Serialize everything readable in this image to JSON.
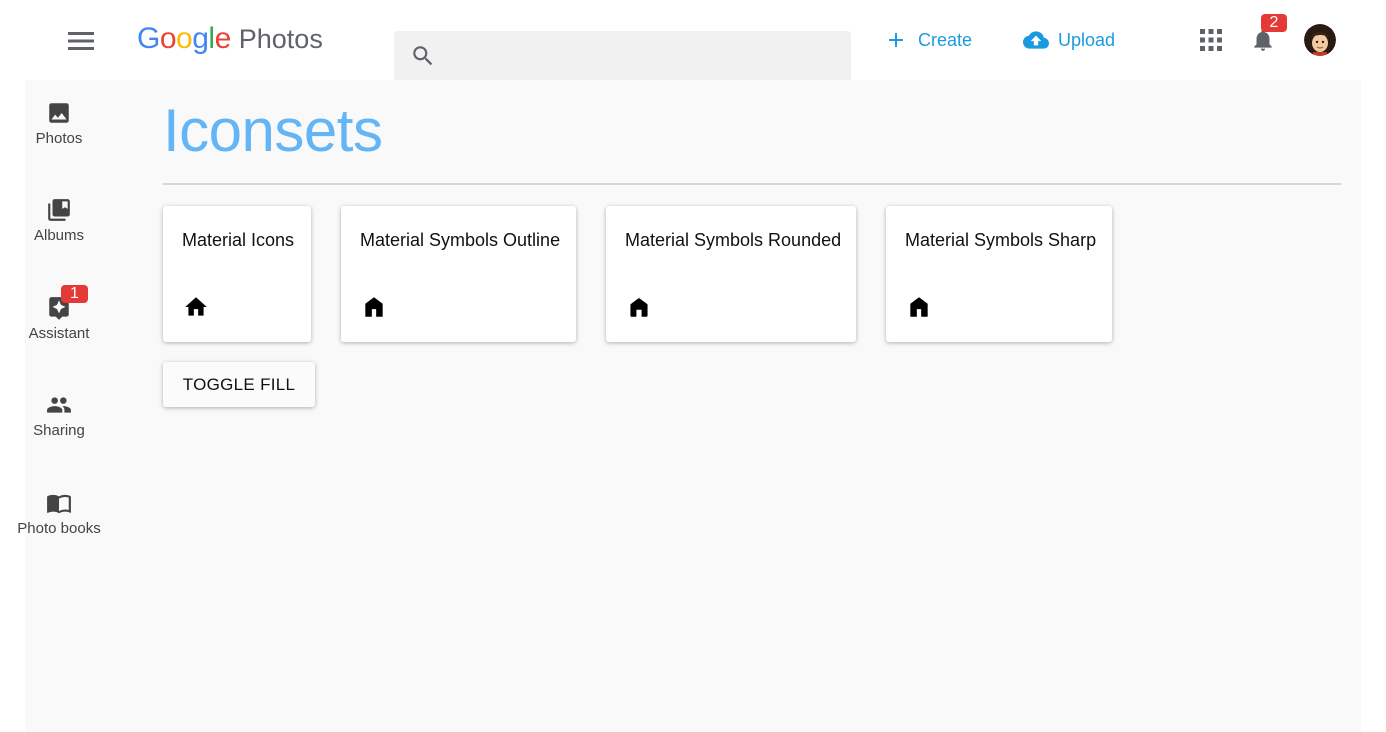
{
  "header": {
    "logo_letters": [
      {
        "ch": "G",
        "color": "#4285f4"
      },
      {
        "ch": "o",
        "color": "#ea4335"
      },
      {
        "ch": "o",
        "color": "#fbbc05"
      },
      {
        "ch": "g",
        "color": "#4285f4"
      },
      {
        "ch": "l",
        "color": "#34a853"
      },
      {
        "ch": "e",
        "color": "#ea4335"
      }
    ],
    "app_name": "Photos",
    "search_placeholder": "",
    "create_label": "Create",
    "upload_label": "Upload",
    "notification_count": "2",
    "accent_color": "#1a9be0"
  },
  "sidebar": {
    "items": [
      {
        "label": "Photos",
        "icon": "photo-icon"
      },
      {
        "label": "Albums",
        "icon": "albums-icon"
      },
      {
        "label": "Assistant",
        "icon": "assistant-icon",
        "badge": "1"
      },
      {
        "label": "Sharing",
        "icon": "people-icon"
      },
      {
        "label": "Photo books",
        "icon": "book-icon"
      }
    ]
  },
  "main": {
    "title": "Iconsets",
    "title_color": "#64b5f6",
    "cards": [
      {
        "title": "Material Icons",
        "icon": "home-icon"
      },
      {
        "title": "Material Symbols Outline",
        "icon": "home-icon"
      },
      {
        "title": "Material Symbols Rounded",
        "icon": "home-icon"
      },
      {
        "title": "Material Symbols Sharp",
        "icon": "home-icon"
      }
    ],
    "toggle_label": "TOGGLE FILL"
  }
}
